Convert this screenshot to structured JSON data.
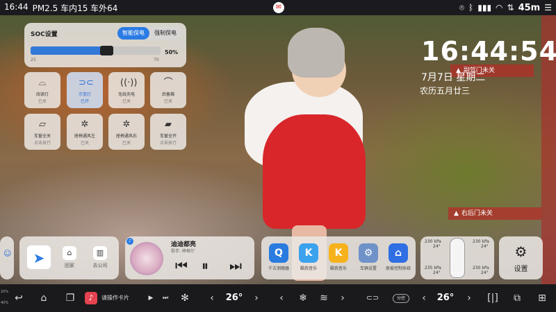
{
  "status_bar": {
    "left": [
      "16:44",
      "PM2.5 车内15 车外64"
    ],
    "right_time": "45m"
  },
  "soc": {
    "title": "SOC设置",
    "tab_smart": "智能保电",
    "tab_force": "强制保电",
    "value_pct": "50%",
    "value": 50,
    "min": "25",
    "max": "70"
  },
  "tiles": [
    {
      "label": "阅读灯",
      "state": "已关",
      "icon": "reading-lamp-icon"
    },
    {
      "label": "示宽灯",
      "state": "已开",
      "icon": "width-lamp-icon"
    },
    {
      "label": "无线充电",
      "state": "已关",
      "icon": "wireless-charge-icon"
    },
    {
      "label": "后备箱",
      "state": "已关",
      "icon": "trunk-icon"
    },
    {
      "label": "车窗全关",
      "state": "点击执行",
      "icon": "window-close-icon"
    },
    {
      "label": "座椅通风左",
      "state": "已关",
      "icon": "seat-vent-left-icon"
    },
    {
      "label": "座椅通风右",
      "state": "已关",
      "icon": "seat-vent-right-icon"
    },
    {
      "label": "车窗全开",
      "state": "点击执行",
      "icon": "window-open-icon"
    }
  ],
  "clock": {
    "time": "16:44:54",
    "date": "7月7日  星期二",
    "lunar": "农历五月廿三"
  },
  "warnings": {
    "sub_door": "副驾门未关",
    "rear_right_door": "右后门未关"
  },
  "nav_card": {
    "home": "回家",
    "company": "去公司"
  },
  "music": {
    "song": "迪迪都亮",
    "artist": "歌手: 婷格尔"
  },
  "apps": [
    {
      "label": "千古测随器",
      "color": "#2a7be0",
      "glyph": "Q"
    },
    {
      "label": "酷我音乐",
      "color": "#3ba2ee",
      "glyph": "K"
    },
    {
      "label": "酷我音乐",
      "color": "#f6b21c",
      "glyph": "K"
    },
    {
      "label": "车辆设置",
      "color": "#6f93c8",
      "glyph": "⚙"
    },
    {
      "label": "原爱控制系统",
      "color": "#2f6fe3",
      "glyph": "⌂"
    }
  ],
  "tires": {
    "fl_kpa": "230 kPa",
    "fl_t": "24°",
    "fr_kpa": "230 kPa",
    "fr_t": "24°",
    "rl_kpa": "235 kPa",
    "rl_t": "24°",
    "rr_kpa": "230 kPa",
    "rr_t": "24°"
  },
  "settings_label": "设置",
  "bottom_bar": {
    "card_label": "请操作卡片",
    "temp_left": "26°",
    "temp_right": "26°",
    "zone_label": "分控",
    "mini_lines": [
      "20%",
      "40%"
    ]
  }
}
